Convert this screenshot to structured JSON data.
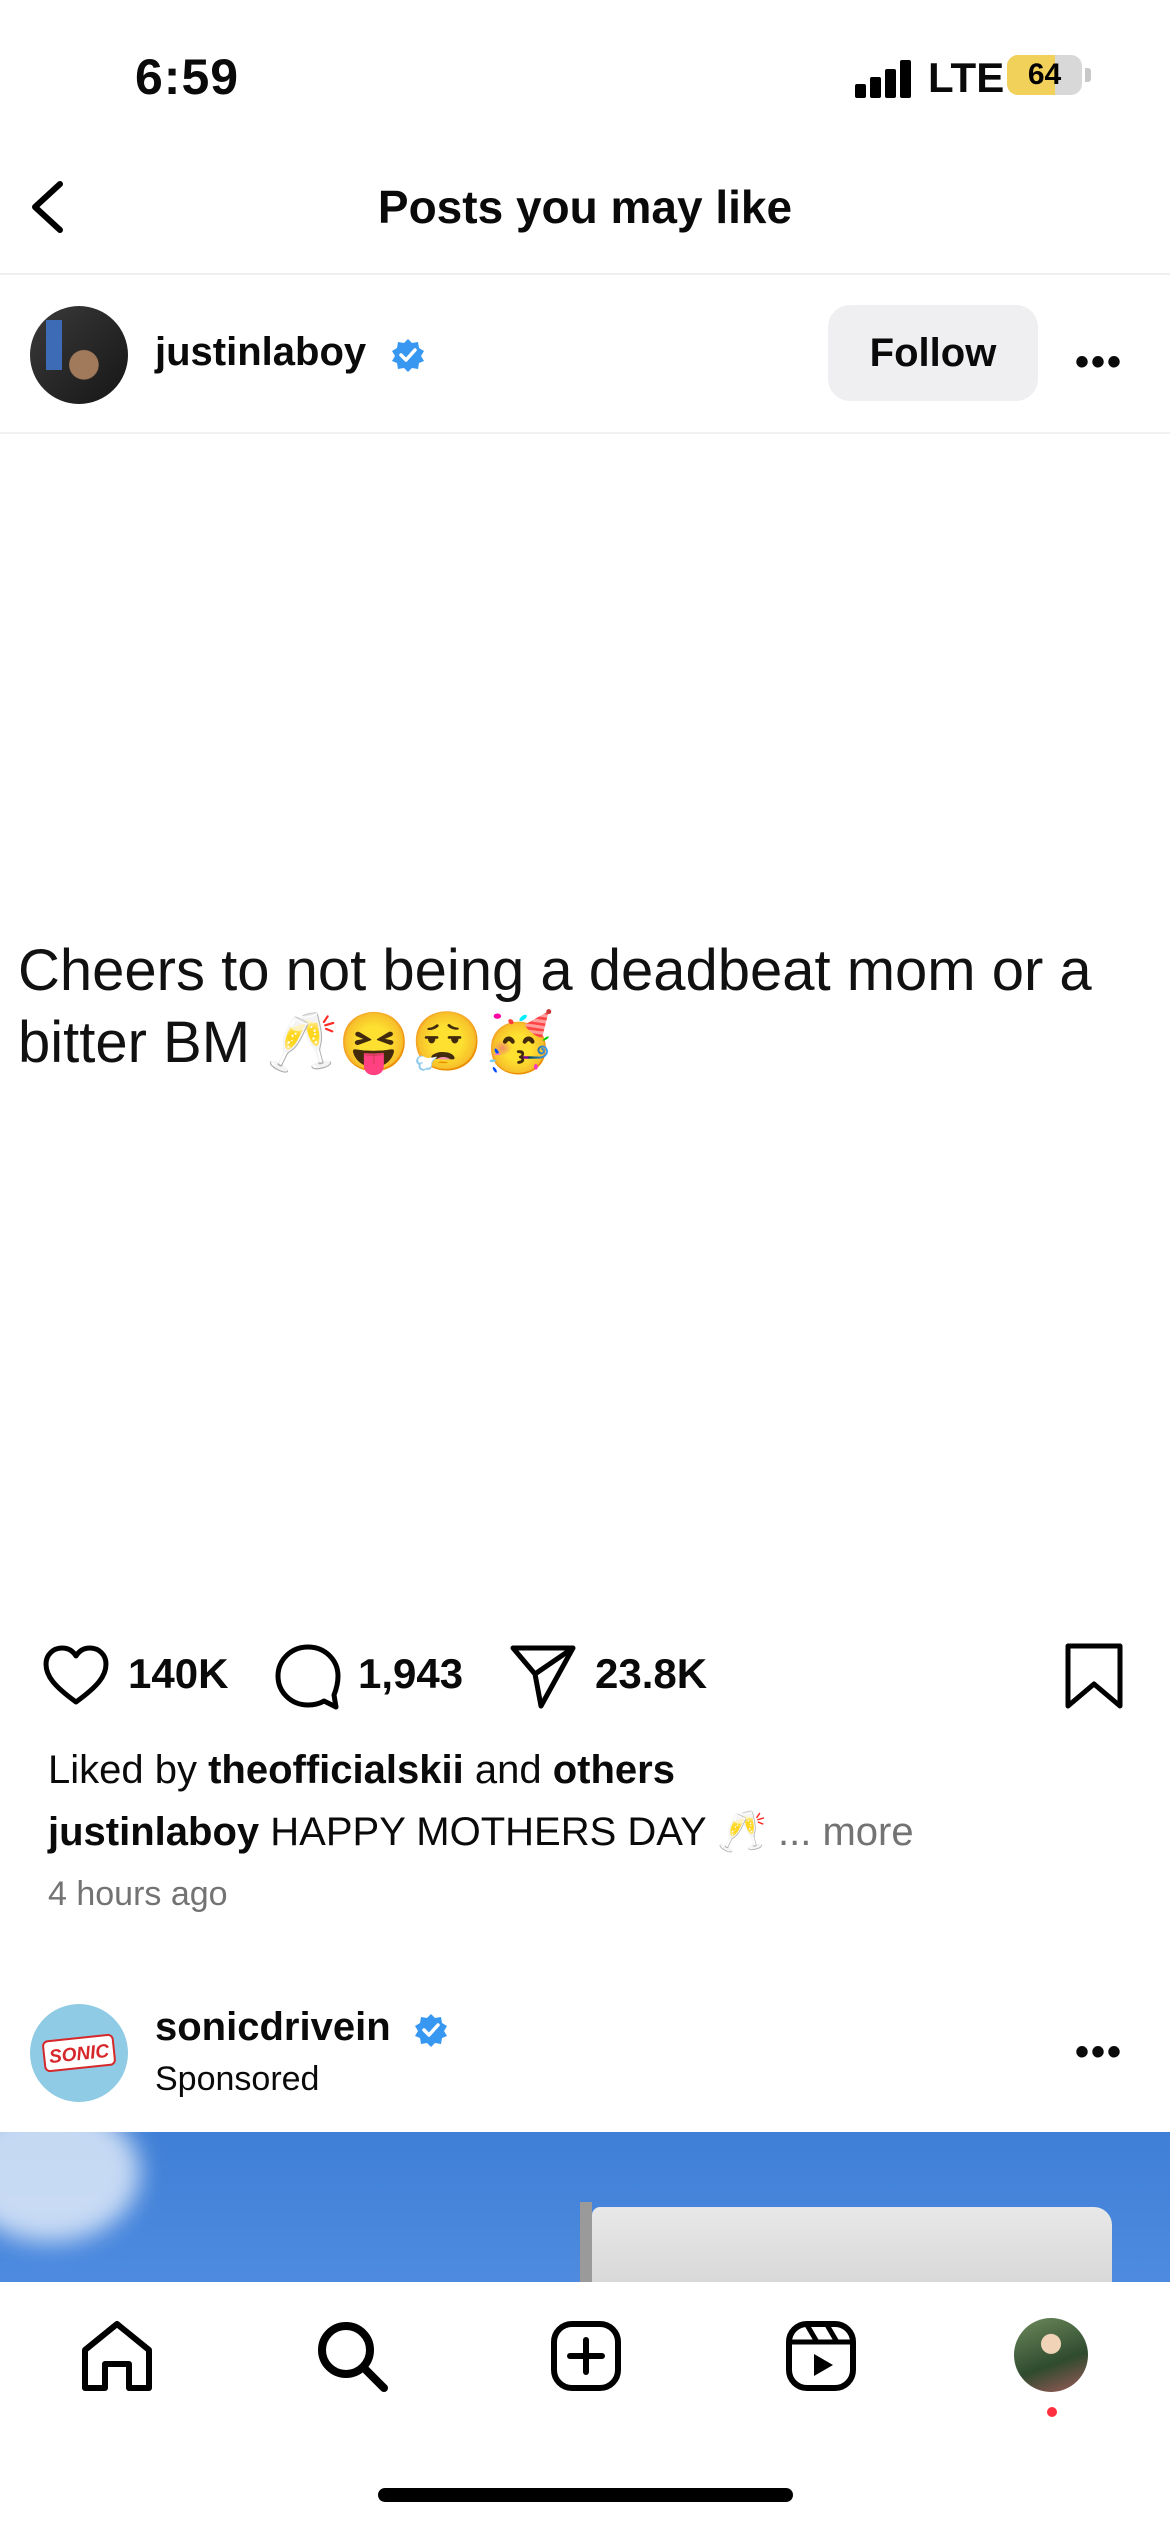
{
  "status_bar": {
    "time": "6:59",
    "network": "LTE",
    "battery": "64"
  },
  "header": {
    "title": "Posts you may like"
  },
  "post": {
    "username": "justinlaboy",
    "follow_label": "Follow",
    "image_text": "Cheers to not being a deadbeat mom or a bitter BM 🥂😝😮‍💨🥳",
    "likes": "140K",
    "comments": "1,943",
    "shares": "23.8K",
    "liked_by_prefix": "Liked by",
    "liked_by_user": "theofficialskii",
    "liked_by_and": "and",
    "liked_by_others": "others",
    "caption_user": "justinlaboy",
    "caption_text": "HAPPY MOTHERS DAY 🥂",
    "caption_more": "... more",
    "time_ago": "4 hours ago"
  },
  "sponsored_post": {
    "username": "sonicdrivein",
    "label": "Sponsored",
    "logo_text": "SONIC"
  },
  "colors": {
    "verified": "#3897f0",
    "follow_bg": "#efeff2",
    "muted": "#737373",
    "notif": "#ff3040"
  },
  "icons": [
    "back-arrow-icon",
    "verified-badge-icon",
    "more-icon",
    "heart-icon",
    "comment-icon",
    "share-icon",
    "bookmark-icon",
    "home-icon",
    "search-icon",
    "add-post-icon",
    "reels-icon"
  ]
}
